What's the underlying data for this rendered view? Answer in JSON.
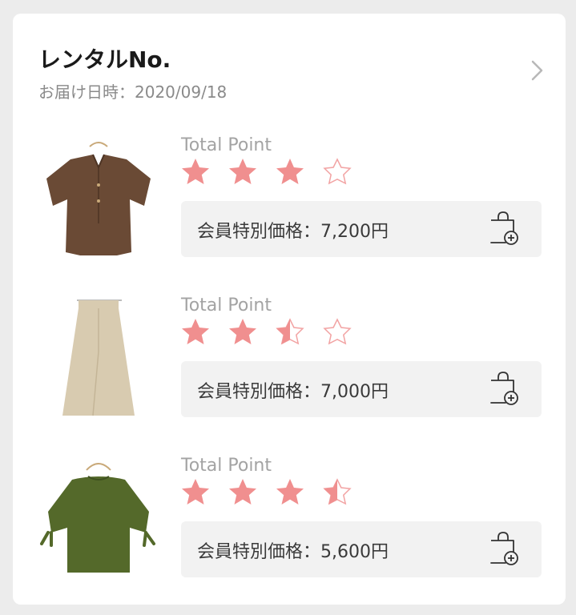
{
  "rental": {
    "title": "レンタルNo.",
    "delivery": "お届け日時：2020/09/18"
  },
  "items": [
    {
      "total_label": "Total Point",
      "rating": 3,
      "price": "会員特別価格：7,200円",
      "image": "brown-blouse"
    },
    {
      "total_label": "Total Point",
      "rating": 2.5,
      "price": "会員特別価格：7,000円",
      "image": "beige-skirt"
    },
    {
      "total_label": "Total Point",
      "rating": 3.5,
      "price": "会員特別価格：5,600円",
      "image": "green-blouse"
    }
  ],
  "colors": {
    "star_fill": "#f08f8f",
    "star_outline": "#f2a3a3"
  },
  "icons": {
    "detail": "chevron-right-icon",
    "add_to_bag": "shopping-bag-plus-icon",
    "rating": "star-icon"
  }
}
